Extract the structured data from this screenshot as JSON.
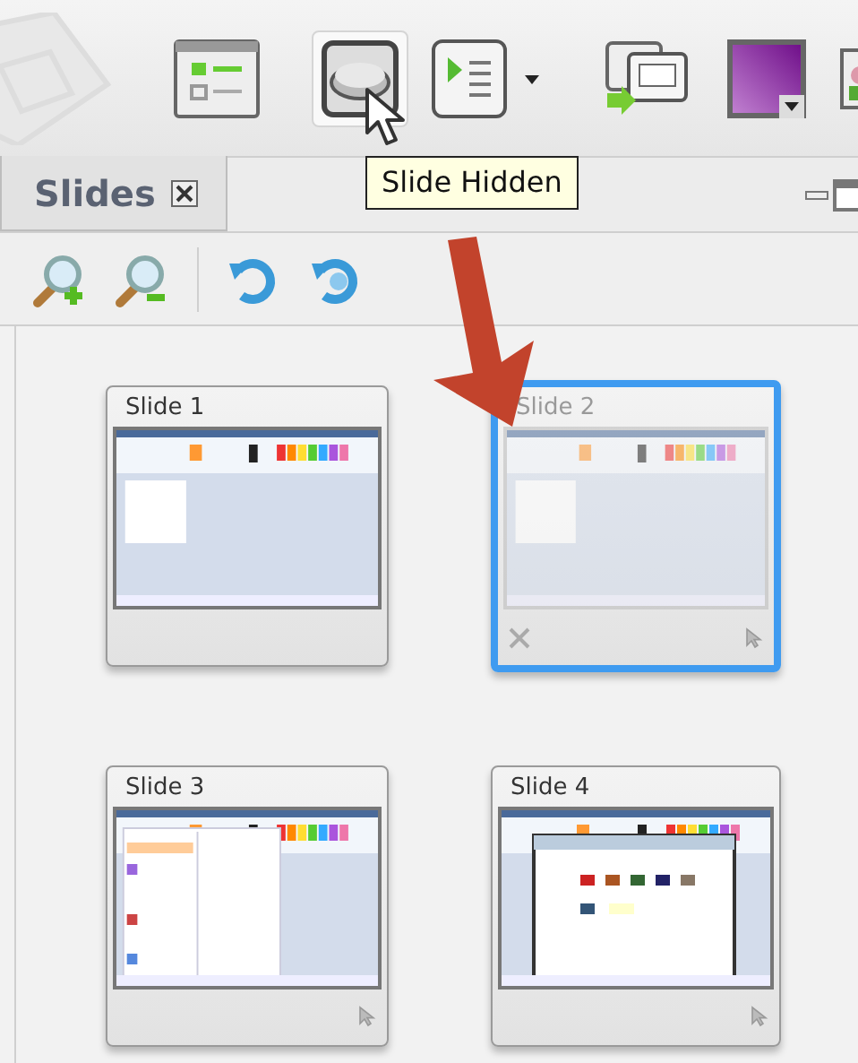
{
  "toolbar": {
    "buttons": [
      {
        "kind": "layout",
        "pressed": false
      },
      {
        "kind": "hide-slide",
        "pressed": true
      },
      {
        "kind": "slideshow",
        "pressed": false
      },
      {
        "kind": "duplicate",
        "pressed": false
      },
      {
        "kind": "color",
        "pressed": false
      },
      {
        "kind": "picture",
        "pressed": false
      }
    ]
  },
  "tooltip": {
    "text": "Slide Hidden"
  },
  "panel": {
    "tabs": [
      {
        "label": "Slides",
        "selected": true
      }
    ]
  },
  "slides": [
    {
      "title": "Slide 1",
      "selected": false,
      "hidden": false,
      "pointer": false,
      "kind": "paint"
    },
    {
      "title": "Slide 2",
      "selected": true,
      "hidden": true,
      "pointer": true,
      "kind": "paint"
    },
    {
      "title": "Slide 3",
      "selected": false,
      "hidden": false,
      "pointer": true,
      "kind": "menu"
    },
    {
      "title": "Slide 4",
      "selected": false,
      "hidden": false,
      "pointer": true,
      "kind": "dialog"
    }
  ]
}
